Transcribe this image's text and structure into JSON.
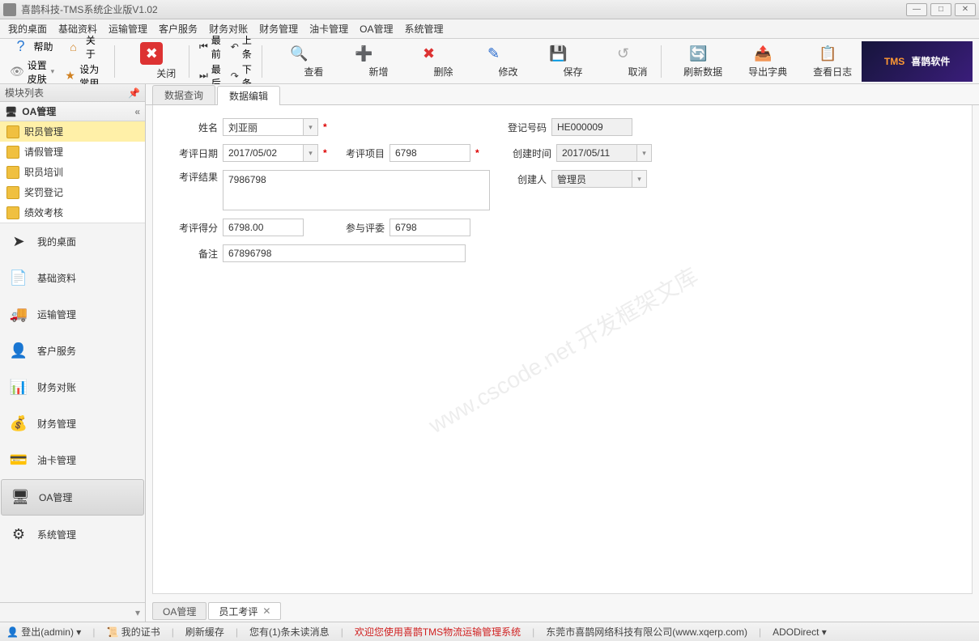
{
  "window": {
    "title": "喜鹊科技-TMS系统企业版V1.02"
  },
  "menu": [
    "我的桌面",
    "基础资料",
    "运输管理",
    "客户服务",
    "财务对账",
    "财务管理",
    "油卡管理",
    "OA管理",
    "系统管理"
  ],
  "toolbar": {
    "help": "帮助",
    "skin": "设置皮肤",
    "about": "关于",
    "set_common": "设为常用",
    "close": "关闭",
    "first": "最前",
    "last": "最后",
    "prev": "上条",
    "next": "下条",
    "view": "查看",
    "add": "新增",
    "delete": "删除",
    "edit": "修改",
    "save": "保存",
    "cancel": "取消",
    "refresh": "刷新数据",
    "export": "导出字典",
    "log": "查看日志"
  },
  "logo": {
    "brand": "TMS",
    "text": "喜鹊软件"
  },
  "sidebar": {
    "header": "模块列表",
    "section": "OA管理",
    "tree": [
      "职员管理",
      "请假管理",
      "职员培训",
      "奖罚登记",
      "绩效考核"
    ],
    "tree_selected": 0,
    "nav": [
      "我的桌面",
      "基础资料",
      "运输管理",
      "客户服务",
      "财务对账",
      "财务管理",
      "油卡管理",
      "OA管理",
      "系统管理"
    ],
    "nav_active": 7
  },
  "tabs_top": [
    "数据查询",
    "数据编辑"
  ],
  "tabs_top_active": 1,
  "form": {
    "name_label": "姓名",
    "name_value": "刘亚丽",
    "reg_label": "登记号码",
    "reg_value": "HE000009",
    "date_label": "考评日期",
    "date_value": "2017/05/02",
    "project_label": "考评项目",
    "project_value": "6798",
    "created_label": "创建时间",
    "created_value": "2017/05/11",
    "result_label": "考评结果",
    "result_value": "7986798",
    "creator_label": "创建人",
    "creator_value": "管理员",
    "score_label": "考评得分",
    "score_value": "6798.00",
    "judge_label": "参与评委",
    "judge_value": "6798",
    "remark_label": "备注",
    "remark_value": "67896798"
  },
  "tabs_bottom": [
    {
      "label": "OA管理",
      "closable": false
    },
    {
      "label": "员工考评",
      "closable": true
    }
  ],
  "tabs_bottom_active": 1,
  "status": {
    "login": "登出(admin)",
    "cert": "我的证书",
    "refresh_cache": "刷新缓存",
    "unread": "您有(1)条未读消息",
    "welcome": "欢迎您使用喜鹊TMS物流运输管理系统",
    "company": "东莞市喜鹊网络科技有限公司(www.xqerp.com)",
    "ado": "ADODirect"
  },
  "watermark": "www.cscode.net 开发框架文库"
}
